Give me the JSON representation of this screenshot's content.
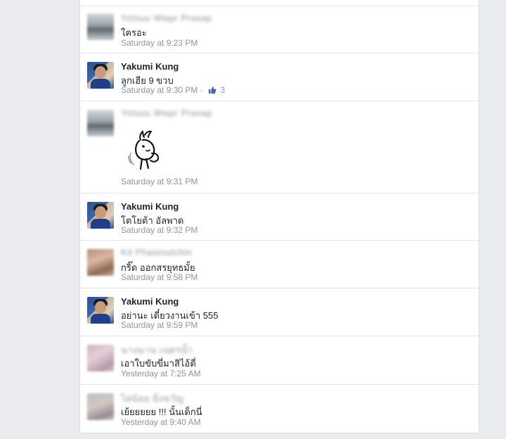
{
  "comments": [
    {
      "name": "Yotsuu Wwpr Prasap",
      "name_blurred": true,
      "avatar": "blurred-photo-a",
      "text": "ใครอะ",
      "time": "Saturday at 9:23 PM"
    },
    {
      "name": "Yakumi Kung",
      "name_blurred": false,
      "avatar": "user-photo",
      "text": "ลูกเฮีย 9 ขวบ",
      "time": "Saturday at 9:30 PM",
      "like_count": "3",
      "separator": "·"
    },
    {
      "name": "Yotsuu Wwpr Prasap",
      "name_blurred": true,
      "avatar": "blurred-photo-a",
      "sticker": "cartoon-character-sticker",
      "time": "Saturday at 9:31 PM"
    },
    {
      "name": "Yakumi Kung",
      "name_blurred": false,
      "avatar": "user-photo",
      "text": "โตโยต้า อัลพาด",
      "time": "Saturday at 9:32 PM"
    },
    {
      "name": "Kit Phasinutchin",
      "name_blurred": true,
      "avatar": "blurred-photo-b",
      "text": "กริ๊ด ออกสรยุทธมั้ย",
      "time": "Saturday at 9:58 PM"
    },
    {
      "name": "Yakumi Kung",
      "name_blurred": false,
      "avatar": "user-photo",
      "text": "อย่านะ เดี๋ยวงานเข้า 555",
      "time": "Saturday at 9:59 PM"
    },
    {
      "name": "นางนาน เนตรน้ำ",
      "name_blurred": true,
      "avatar": "blurred-photo-c",
      "text": "เอาใบขับขี่มาสิไอ้ตี่",
      "time": "Yesterday at 7:25 AM"
    },
    {
      "name": "ไฝน้อย มิ่งขวัญ",
      "name_blurred": true,
      "avatar": "blurred-photo-d",
      "text": "เย้ยยยยย !!! นั้นเด็กนี่",
      "time": "Yesterday at 9:40 AM"
    }
  ],
  "colors": {
    "background": "#e9ebee",
    "name": "#1d2129",
    "meta": "#90949c",
    "like": "#4267b2"
  }
}
